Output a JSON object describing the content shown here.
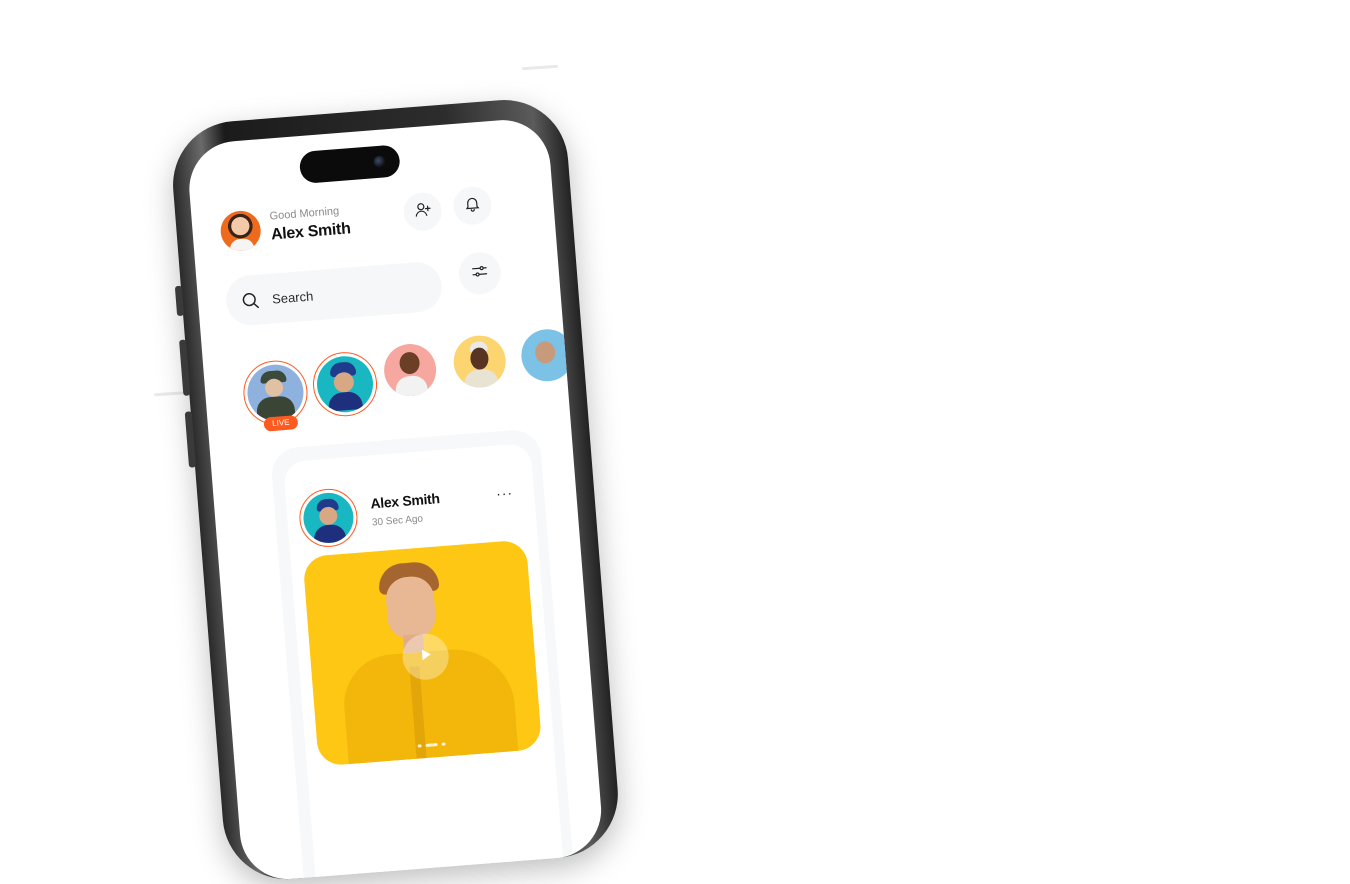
{
  "header": {
    "greeting": "Good Morning",
    "user_name": "Alex Smith"
  },
  "search": {
    "placeholder": "Search"
  },
  "stories": [
    {
      "badge": "LIVE",
      "ring_color": "#ff5a1f",
      "background": "#8fb1de"
    },
    {
      "ring_color": "#ff5a1f",
      "background": "#19b7c1"
    },
    {
      "background": "#f6a7a0"
    },
    {
      "background": "#fcd571"
    },
    {
      "background": "#7cc1e6"
    }
  ],
  "post": {
    "author": "Alex Smith",
    "time": "30 Sec Ago",
    "more_label": "···",
    "media_background": "#fdc713"
  },
  "icons": [
    "add-user-icon",
    "bell-icon",
    "search-icon",
    "filter-icon",
    "play-icon",
    "more-icon"
  ],
  "colors": {
    "accent": "#ff5a1f",
    "surface": "#f6f7f9",
    "text": "#111111",
    "muted": "#8a8a8a"
  }
}
